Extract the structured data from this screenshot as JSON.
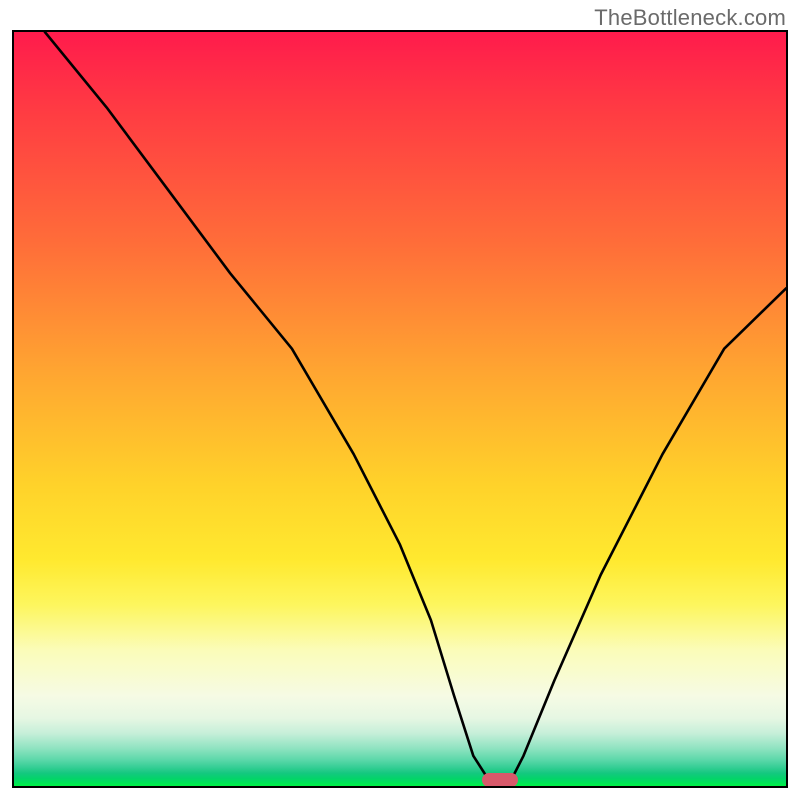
{
  "watermark": "TheBottleneck.com",
  "chart_data": {
    "type": "line",
    "title": "",
    "xlabel": "",
    "ylabel": "",
    "xlim": [
      0,
      100
    ],
    "ylim": [
      0,
      100
    ],
    "grid": false,
    "legend": false,
    "series": [
      {
        "name": "bottleneck-curve",
        "x": [
          4,
          12,
          20,
          28,
          36,
          44,
          50,
          54,
          57,
          59.5,
          62,
          64,
          66,
          70,
          76,
          84,
          92,
          100
        ],
        "y": [
          100,
          90,
          79,
          68,
          58,
          44,
          32,
          22,
          12,
          4,
          0,
          0,
          4,
          14,
          28,
          44,
          58,
          66
        ]
      }
    ],
    "marker": {
      "x": 63,
      "y": 0.8,
      "shape": "pill",
      "color": "#d7596a"
    },
    "background_gradient_stops": [
      {
        "pos": 0.0,
        "color": "#ff1b4c"
      },
      {
        "pos": 0.28,
        "color": "#ff6d39"
      },
      {
        "pos": 0.6,
        "color": "#ffd22a"
      },
      {
        "pos": 0.82,
        "color": "#fbfcb9"
      },
      {
        "pos": 0.95,
        "color": "#8fe3c1"
      },
      {
        "pos": 1.0,
        "color": "#00f146"
      }
    ]
  }
}
